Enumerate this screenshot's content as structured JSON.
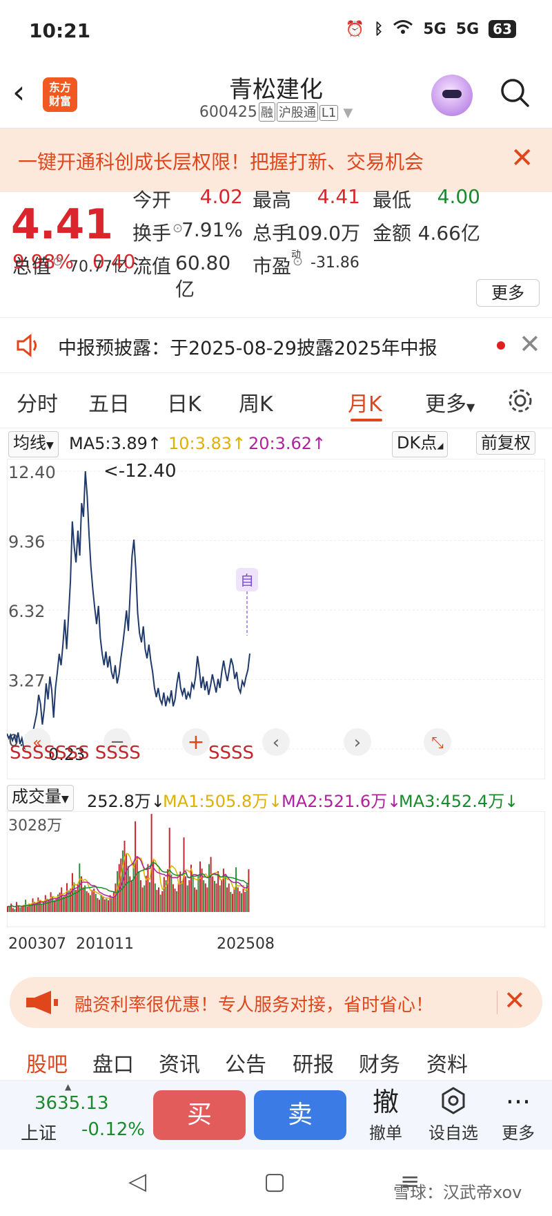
{
  "status_bar": {
    "time": "10:21",
    "signal_1": "5G",
    "signal_2": "5G",
    "battery": "63"
  },
  "header": {
    "back_icon": "chevron-left-icon",
    "logo_line1": "东方",
    "logo_line2": "财富",
    "stock_name": "青松建化",
    "stock_code": "600425",
    "tag_margin": "融",
    "tag_connect": "沪股通",
    "tag_level": "L1"
  },
  "promo_banner": {
    "text": "一键开通科创成长层权限！把握打新、交易机会",
    "close": "✕"
  },
  "quote": {
    "price": "4.41",
    "change_pct": "9.98%",
    "change": "0.40",
    "open_label": "今开",
    "open": "4.02",
    "high_label": "最高",
    "high": "4.41",
    "low_label": "最低",
    "low": "4.00",
    "turnover_label": "换手",
    "turnover": "7.91%",
    "volume_label": "总手",
    "volume": "109.0万",
    "amount_label": "金额",
    "amount": "4.66亿",
    "mktcap_label": "总值",
    "mktcap": "70.77亿",
    "float_label": "流值",
    "float_cap": "60.80亿",
    "pe_label": "市盈",
    "pe_sup": "动",
    "pe": "-31.86",
    "more": "更多"
  },
  "notice": {
    "text": "中报预披露：于2025-08-29披露2025年中报",
    "close": "✕"
  },
  "tabs": {
    "items": [
      "分时",
      "五日",
      "日K",
      "周K",
      "月K",
      "更多"
    ],
    "active": "月K"
  },
  "ma_bar": {
    "indicator": "均线",
    "ma5": "MA5:3.89↑",
    "ma10": "10:3.83↑",
    "ma20": "20:3.62↑",
    "dk": "DK点",
    "adjust": "前复权",
    "colors": {
      "ma5": "#222222",
      "ma10": "#e0b000",
      "ma20": "#b0229d"
    }
  },
  "chart_labels": {
    "max_marker": "<-12.40",
    "min_marker": "0.23",
    "self_marker": "自",
    "signals_left": "SSSSSSS SSSS",
    "signals_right": "SSSS"
  },
  "chart_data": [
    {
      "type": "line",
      "title": "",
      "yticks": [
        "12.40",
        "9.36",
        "6.32",
        "3.27",
        "0.23"
      ],
      "ylim": [
        0.23,
        12.4
      ],
      "x_start": "200307",
      "x_end": "202508",
      "series": [
        {
          "values": [
            0.9,
            0.7,
            0.85,
            0.6,
            0.8,
            0.5,
            0.95,
            0.45,
            0.7,
            0.3,
            0.23,
            0.5,
            0.6,
            0.9,
            1.0,
            1.4,
            1.8,
            2.6,
            2.2,
            1.3,
            2.0,
            3.1,
            2.4,
            3.4,
            2.8,
            1.6,
            2.9,
            3.6,
            4.4,
            3.9,
            4.8,
            5.9,
            4.6,
            6.1,
            7.6,
            10.2,
            9.1,
            8.4,
            9.8,
            8.7,
            11.0,
            10.4,
            12.4,
            11.3,
            9.6,
            8.2,
            7.2,
            6.4,
            5.7,
            6.5,
            5.1,
            4.4,
            3.9,
            4.5,
            3.8,
            4.3,
            3.6,
            3.3,
            3.9,
            3.1,
            3.5,
            4.2,
            4.8,
            5.5,
            6.3,
            5.4,
            7.1,
            8.7,
            9.4,
            8.1,
            6.2,
            5.3,
            4.9,
            5.6,
            4.6,
            4.2,
            4.8,
            4.1,
            3.6,
            2.9,
            2.5,
            2.9,
            2.4,
            2.2,
            2.7,
            2.1,
            2.5,
            2.3,
            2.8,
            2.1,
            2.4,
            3.1,
            3.6,
            2.9,
            2.6,
            2.9,
            2.4,
            2.7,
            2.5,
            3.1,
            2.9,
            3.4,
            4.3,
            3.7,
            2.9,
            3.4,
            2.8,
            3.2,
            2.6,
            3.0,
            3.5,
            3.1,
            2.7,
            3.3,
            2.9,
            3.6,
            4.1,
            3.6,
            3.2,
            3.7,
            4.2,
            3.9,
            3.3,
            3.6,
            2.9,
            2.7,
            3.2,
            3.0,
            3.4,
            3.7,
            4.41
          ]
        }
      ]
    },
    {
      "type": "bar",
      "title": "",
      "ytick": "3028万",
      "ylim": [
        0,
        3028
      ],
      "xticks": [
        "200307",
        "201011",
        "202508"
      ],
      "series_labels": {
        "volume": "252.8万↓",
        "ma1": "MA1:505.8万↓",
        "ma2": "MA2:521.6万↓",
        "ma3": "MA3:452.4万↓"
      },
      "series": [
        {
          "values": [
            180,
            150,
            260,
            120,
            90,
            310,
            200,
            140,
            160,
            220,
            380,
            170,
            260,
            190,
            420,
            310,
            280,
            450,
            360,
            240,
            300,
            520,
            410,
            390,
            610,
            480,
            360,
            420,
            540,
            600,
            760,
            480,
            520,
            890,
            640,
            720,
            1200,
            910,
            680,
            850,
            1500,
            1100,
            760,
            820,
            640,
            590,
            520,
            680,
            720,
            560,
            430,
            380,
            520,
            460,
            390,
            410,
            360,
            520,
            480,
            640,
            880,
            1260,
            1480,
            1650,
            1900,
            2200,
            1800,
            1420,
            1100,
            980,
            1560,
            2800,
            1700,
            1260,
            980,
            760,
            820,
            1120,
            1480,
            920,
            3028,
            1600,
            880,
            680,
            760,
            540,
            640,
            1080,
            980,
            1320,
            2600,
            1160,
            860,
            720,
            640,
            880,
            1250,
            960,
            2300,
            1100,
            820,
            980,
            1460,
            1080,
            760,
            690,
            1120,
            1560,
            1340,
            980,
            880,
            760,
            1480,
            1700,
            1100,
            960,
            880,
            1260,
            820,
            980,
            1340,
            1120,
            760,
            880,
            620,
            560,
            720,
            1380,
            760,
            640,
            580,
            720,
            620,
            860,
            1320
          ]
        }
      ]
    }
  ],
  "margin_ad": {
    "text": "融资利率很优惠！专人服务对接，省时省心！",
    "close": "✕"
  },
  "bottom_tabs": {
    "items": [
      "股吧",
      "盘口",
      "资讯",
      "公告",
      "研报",
      "财务",
      "资料"
    ],
    "active": "股吧"
  },
  "trade_bar": {
    "index_value": "3635.13",
    "index_name": "上证",
    "index_change": "-0.12%",
    "buy": "买",
    "sell": "卖",
    "cancel_icon": "撤",
    "cancel": "撤单",
    "watch": "设自选",
    "more": "更多"
  },
  "watermark": "雪球：汉武帝xov"
}
